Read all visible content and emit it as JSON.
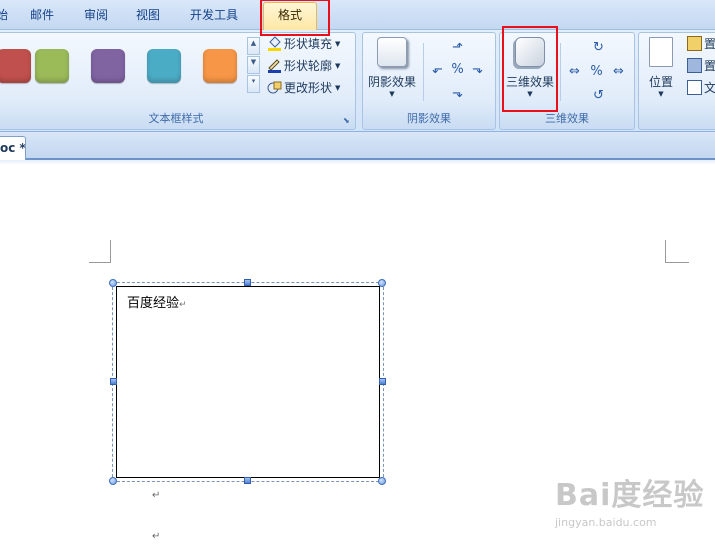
{
  "tabs": [
    {
      "label": "开始",
      "clipped": "始"
    },
    {
      "label": "邮件"
    },
    {
      "label": "审阅"
    },
    {
      "label": "视图"
    },
    {
      "label": "开发工具"
    },
    {
      "label": "格式",
      "active": true
    }
  ],
  "ribbon": {
    "textbox_styles": {
      "label": "文本框样式",
      "swatch_colors": [
        "#c0504d",
        "#9bbb59",
        "#8064a2",
        "#4bacc6",
        "#f79646"
      ],
      "commands": [
        {
          "label": "形状填充",
          "icon": "paint-bucket-icon"
        },
        {
          "label": "形状轮廓",
          "icon": "pencil-icon"
        },
        {
          "label": "更改形状",
          "icon": "change-shape-icon"
        }
      ]
    },
    "shadow_effects": {
      "label": "阴影效果",
      "button_label": "阴影效果"
    },
    "three_d_effects": {
      "label": "三维效果",
      "button_label": "三维效果"
    },
    "arrange": {
      "position_label": "位置",
      "cmd1": "置",
      "cmd2": "置",
      "cmd3": "文"
    }
  },
  "document_tab": {
    "label": "oc *"
  },
  "document": {
    "textbox_text": "百度经验",
    "paragraph_mark": "↵"
  },
  "watermark": {
    "logo": "Bai度经验",
    "url": "jingyan.baidu.com"
  },
  "colors": {
    "highlight": "#e8111b",
    "accent": "#15428b"
  }
}
